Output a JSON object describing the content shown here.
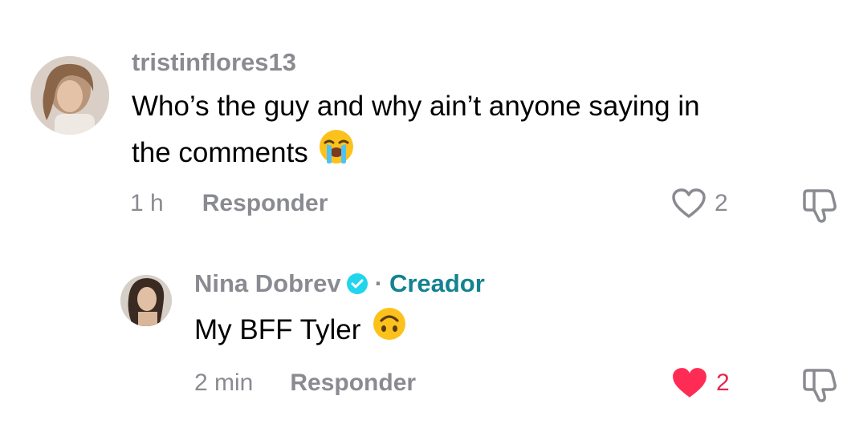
{
  "comments": [
    {
      "username": "tristinflores13",
      "text_line1": "Who’s the guy and why ain’t anyone saying in",
      "text_line2": "the comments",
      "emoji": "loudly-crying-face-emoji",
      "time": "1 h",
      "reply_label": "Responder",
      "like_count": "2",
      "liked": false
    },
    {
      "username": "Nina Dobrev",
      "verified": true,
      "separator": "·",
      "creator_label": "Creador",
      "text": "My BFF Tyler",
      "emoji": "upside-down-face-emoji",
      "time": "2 min",
      "reply_label": "Responder",
      "like_count": "2",
      "liked": true
    }
  ],
  "colors": {
    "muted": "#8a8b91",
    "like_active": "#fe2c55",
    "creator": "#12838f",
    "verified": "#20d5ec"
  },
  "icons": [
    "heart-outline-icon",
    "heart-filled-icon",
    "thumbs-down-icon",
    "verified-badge-icon"
  ]
}
